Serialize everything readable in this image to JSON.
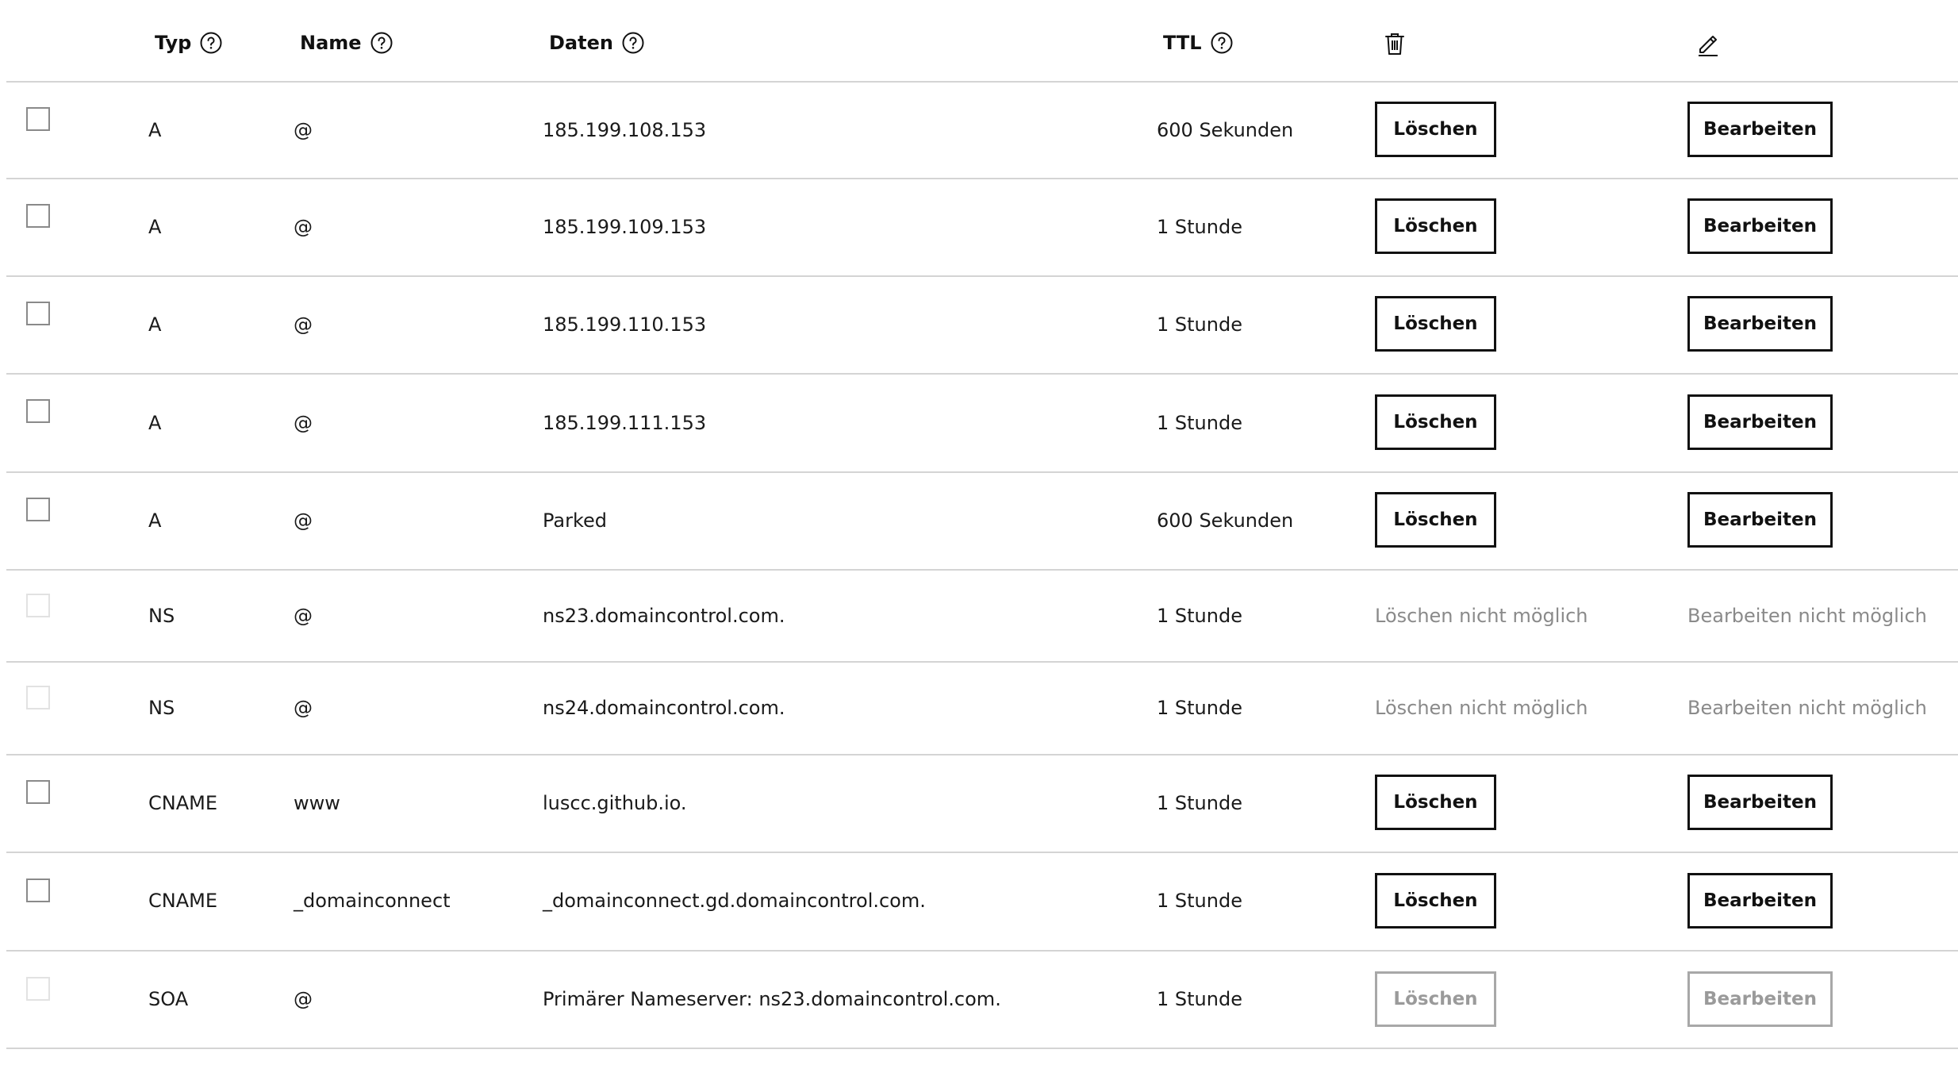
{
  "header": {
    "type": "Typ",
    "name": "Name",
    "data": "Daten",
    "ttl": "TTL",
    "delete_icon": "trash-icon",
    "edit_icon": "pencil-icon",
    "help_icon": "help-circle-icon"
  },
  "rows": [
    {
      "type": "A",
      "name": "@",
      "data": "185.199.108.153",
      "ttl": "600 Sekunden",
      "delete": "Löschen",
      "edit": "Bearbeiten",
      "state": "active"
    },
    {
      "type": "A",
      "name": "@",
      "data": "185.199.109.153",
      "ttl": "1 Stunde",
      "delete": "Löschen",
      "edit": "Bearbeiten",
      "state": "active"
    },
    {
      "type": "A",
      "name": "@",
      "data": "185.199.110.153",
      "ttl": "1 Stunde",
      "delete": "Löschen",
      "edit": "Bearbeiten",
      "state": "active"
    },
    {
      "type": "A",
      "name": "@",
      "data": "185.199.111.153",
      "ttl": "1 Stunde",
      "delete": "Löschen",
      "edit": "Bearbeiten",
      "state": "active"
    },
    {
      "type": "A",
      "name": "@",
      "data": "Parked",
      "ttl": "600 Sekunden",
      "delete": "Löschen",
      "edit": "Bearbeiten",
      "state": "active"
    },
    {
      "type": "NS",
      "name": "@",
      "data": "ns23.domaincontrol.com.",
      "ttl": "1 Stunde",
      "delete": "Löschen nicht möglich",
      "edit": "Bearbeiten nicht möglich",
      "state": "locked"
    },
    {
      "type": "NS",
      "name": "@",
      "data": "ns24.domaincontrol.com.",
      "ttl": "1 Stunde",
      "delete": "Löschen nicht möglich",
      "edit": "Bearbeiten nicht möglich",
      "state": "locked"
    },
    {
      "type": "CNAME",
      "name": "www",
      "data": "luscc.github.io.",
      "ttl": "1 Stunde",
      "delete": "Löschen",
      "edit": "Bearbeiten",
      "state": "active"
    },
    {
      "type": "CNAME",
      "name": "_domainconnect",
      "data": "_domainconnect.gd.domaincontrol.com.",
      "ttl": "1 Stunde",
      "delete": "Löschen",
      "edit": "Bearbeiten",
      "state": "active"
    },
    {
      "type": "SOA",
      "name": "@",
      "data": "Primärer Nameserver: ns23.domaincontrol.com.",
      "ttl": "1 Stunde",
      "delete": "Löschen",
      "edit": "Bearbeiten",
      "state": "disabled"
    }
  ]
}
